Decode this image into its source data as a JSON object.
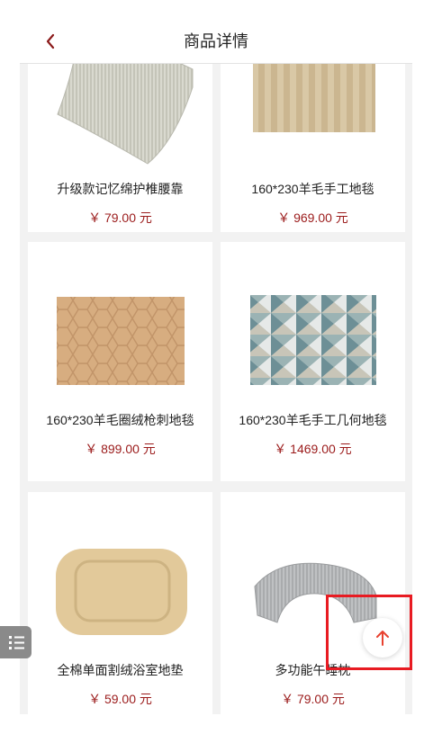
{
  "header": {
    "title": "商品详情"
  },
  "products": [
    {
      "name": "升级款记忆绵护椎腰靠",
      "price": "￥ 79.00 元"
    },
    {
      "name": "160*230羊毛手工地毯",
      "price": "￥ 969.00 元"
    },
    {
      "name": "160*230羊毛圈绒枪刺地毯",
      "price": "￥ 899.00 元"
    },
    {
      "name": "160*230羊毛手工几何地毯",
      "price": "￥ 1469.00 元"
    },
    {
      "name": "全棉单面割绒浴室地垫",
      "price": "￥ 59.00 元"
    },
    {
      "name": "多功能午睡枕",
      "price": "￥ 79.00 元"
    }
  ],
  "icons": {
    "back": "chevron-left-icon",
    "to_top": "arrow-up-icon",
    "menu": "list-icon"
  },
  "colors": {
    "accent": "#9b1b1b",
    "fab_arrow": "#e8412f",
    "highlight": "#e81b22"
  }
}
